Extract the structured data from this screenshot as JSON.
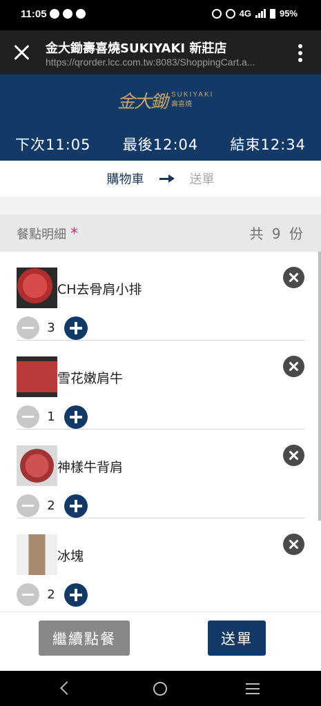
{
  "status_bar": {
    "time": "11:05",
    "network": "4G",
    "battery": "95%"
  },
  "browser": {
    "title": "金大鋤壽喜燒SUKIYAKI 新莊店",
    "url": "https://qrorder.lcc.com.tw:8083/ShoppingCart.a..."
  },
  "brand": {
    "logo_mark": "金大鋤",
    "logo_en": "SUKIYAKI",
    "logo_zh": "壽喜燒"
  },
  "times": {
    "next": "下次11:05",
    "last": "最後12:04",
    "end": "結束12:34"
  },
  "steps": {
    "current": "購物車",
    "next": "送單"
  },
  "section": {
    "title": "餐點明細",
    "asterisk": "*",
    "total_prefix": "共",
    "total_count": "9",
    "total_suffix": "份"
  },
  "items": [
    {
      "name": "CH去骨肩小排",
      "qty": "3"
    },
    {
      "name": "雪花嫩肩牛",
      "qty": "1"
    },
    {
      "name": "神樣牛背肩",
      "qty": "2"
    },
    {
      "name": "冰塊",
      "qty": "2"
    }
  ],
  "actions": {
    "continue_label": "繼續點餐",
    "submit_label": "送單"
  },
  "colors": {
    "brand_navy": "#133a67",
    "gray_button": "#888888",
    "accent_pink": "#e0287a"
  }
}
